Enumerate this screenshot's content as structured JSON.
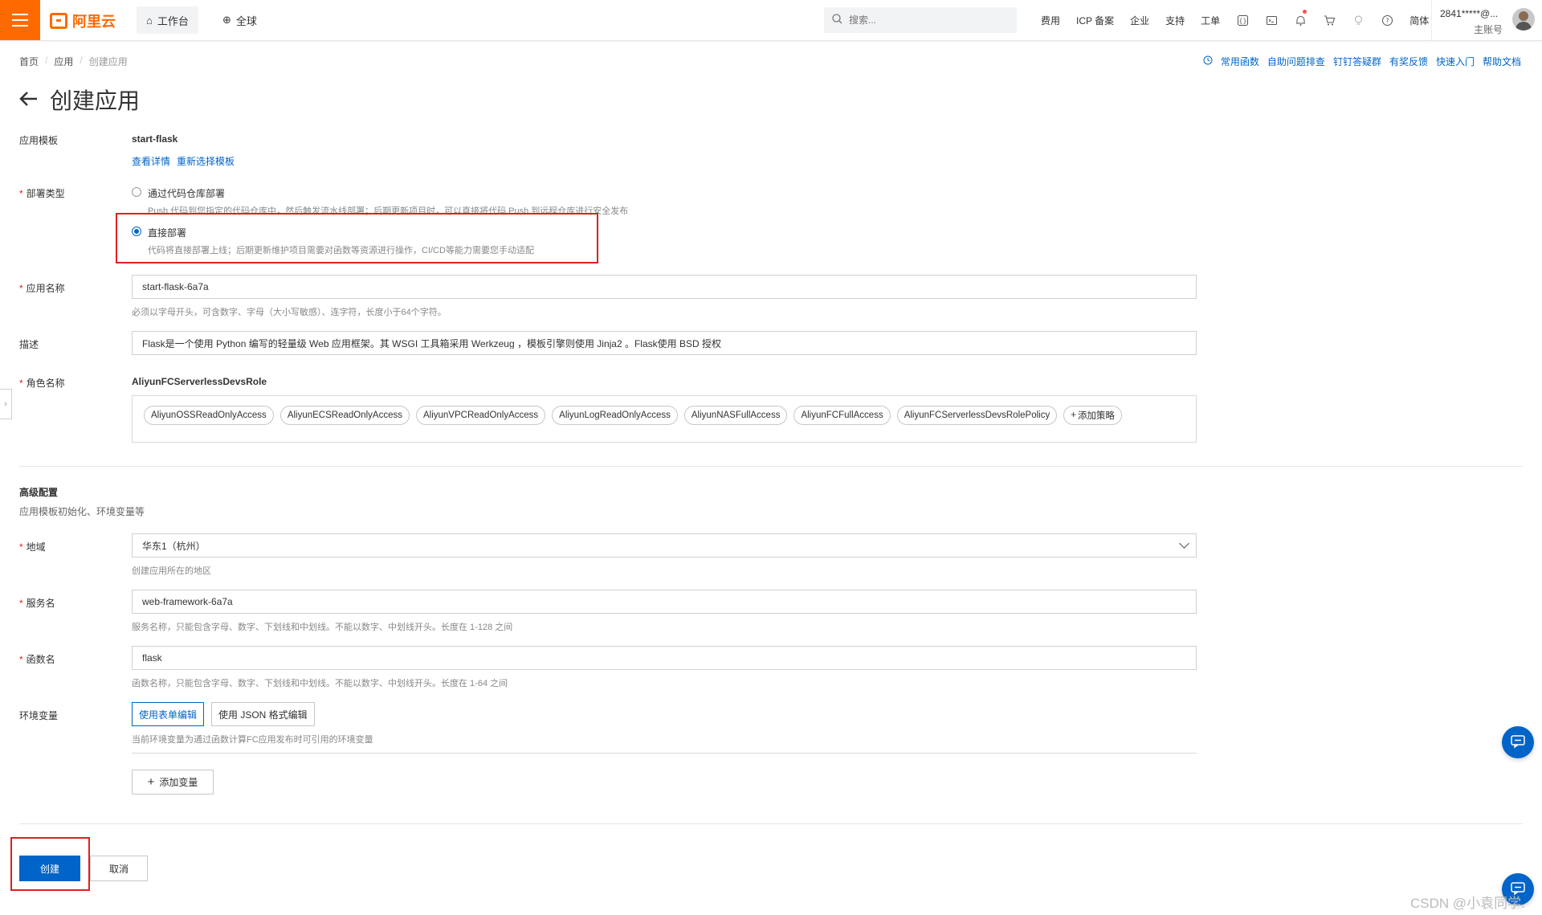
{
  "topbar": {
    "logo_text": "阿里云",
    "workbench": "工作台",
    "region": "全球",
    "search_placeholder": "搜索...",
    "links": [
      "费用",
      "ICP 备案",
      "企业",
      "支持",
      "工单"
    ],
    "language": "简体",
    "account_name": "2841*****@...",
    "account_sub": "主账号"
  },
  "breadcrumb": [
    "首页",
    "应用",
    "创建应用"
  ],
  "help_links": [
    "常用函数",
    "自助问题排查",
    "钉钉答疑群",
    "有奖反馈",
    "快速入门",
    "帮助文档"
  ],
  "page_title": "创建应用",
  "form": {
    "template": {
      "label": "应用模板",
      "value": "start-flask",
      "view_details": "查看详情",
      "reselect": "重新选择模板"
    },
    "deploy_type": {
      "label": "部署类型",
      "options": [
        {
          "title": "通过代码仓库部署",
          "desc": "Push 代码到您指定的代码仓库中，然后触发流水线部署；后期更新项目时，可以直接将代码 Push 到远程仓库进行安全发布",
          "selected": false
        },
        {
          "title": "直接部署",
          "desc": "代码将直接部署上线；后期更新维护项目需要对函数等资源进行操作，CI/CD等能力需要您手动适配",
          "selected": true
        }
      ]
    },
    "app_name": {
      "label": "应用名称",
      "value": "start-flask-6a7a",
      "hint": "必须以字母开头，可含数字、字母（大小写敏感）、连字符，长度小于64个字符。"
    },
    "description": {
      "label": "描述",
      "value": "Flask是一个使用 Python 编写的轻量级 Web 应用框架。其 WSGI 工具箱采用 Werkzeug ，模板引擎则使用 Jinja2 。Flask使用 BSD 授权"
    },
    "role": {
      "label": "角色名称",
      "value": "AliyunFCServerlessDevsRole",
      "policies": [
        "AliyunOSSReadOnlyAccess",
        "AliyunECSReadOnlyAccess",
        "AliyunVPCReadOnlyAccess",
        "AliyunLogReadOnlyAccess",
        "AliyunNASFullAccess",
        "AliyunFCFullAccess",
        "AliyunFCServerlessDevsRolePolicy"
      ],
      "add_policy": "添加策略"
    }
  },
  "advanced": {
    "title": "高级配置",
    "subtitle": "应用模板初始化、环境变量等",
    "region": {
      "label": "地域",
      "value": "华东1（杭州）",
      "hint": "创建应用所在的地区"
    },
    "service": {
      "label": "服务名",
      "value": "web-framework-6a7a",
      "hint": "服务名称，只能包含字母、数字、下划线和中划线。不能以数字、中划线开头。长度在 1-128 之间"
    },
    "function": {
      "label": "函数名",
      "value": "flask",
      "hint": "函数名称，只能包含字母、数字、下划线和中划线。不能以数字、中划线开头。长度在 1-64 之间"
    },
    "env": {
      "label": "环境变量",
      "form_edit": "使用表单编辑",
      "json_edit": "使用 JSON 格式编辑",
      "hint": "当前环境变量为通过函数计算FC应用发布时可引用的环境变量",
      "add_var": "添加变量"
    }
  },
  "actions": {
    "create": "创建",
    "cancel": "取消"
  },
  "watermark": "CSDN @小袁同学.",
  "colors": {
    "brand": "#ff6a00",
    "primary": "#0064c8",
    "highlight": "#e02020"
  }
}
